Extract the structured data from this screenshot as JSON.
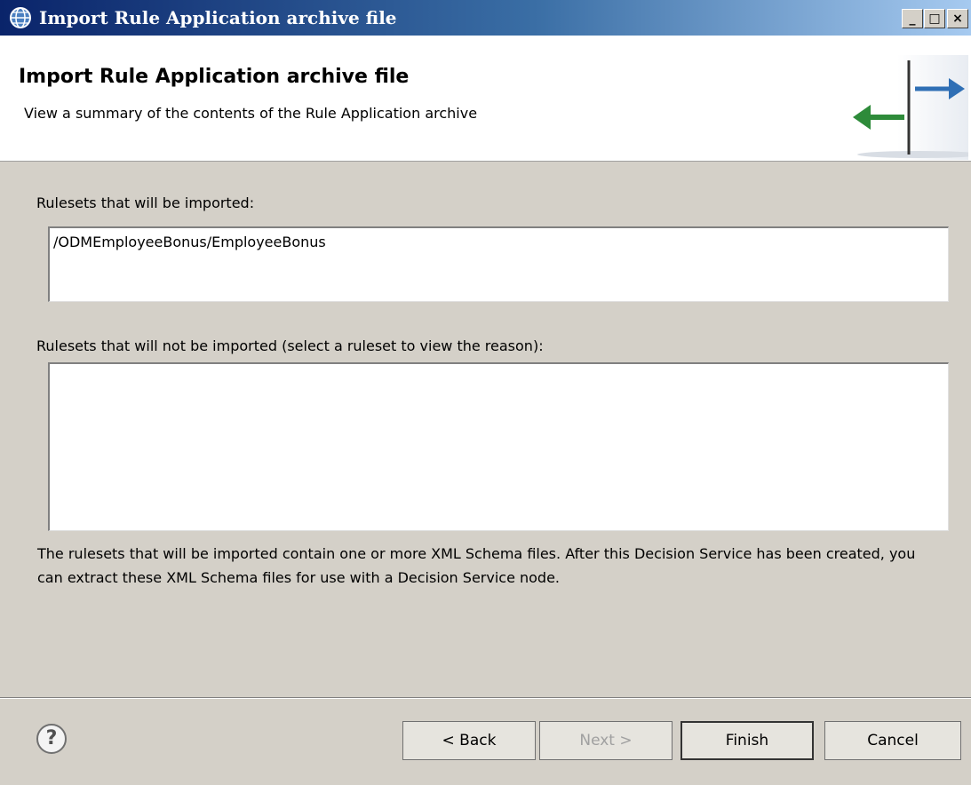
{
  "window": {
    "title": "Import Rule Application archive file",
    "controls": {
      "minimize": "_",
      "maximize": "□",
      "close": "×"
    }
  },
  "header": {
    "title": "Import Rule Application archive file",
    "subtitle": "View a summary of the contents of the Rule Application archive"
  },
  "imported": {
    "label": "Rulesets that will be imported:",
    "items": [
      "/ODMEmployeeBonus/EmployeeBonus"
    ]
  },
  "not_imported": {
    "label": "Rulesets that will not be imported (select a ruleset to view the reason):",
    "items": []
  },
  "note": "The rulesets that will be imported contain one or more XML Schema files. After this Decision Service has been created, you can extract these XML Schema files for use with a Decision Service node.",
  "footer": {
    "help": "?",
    "back": "< Back",
    "next": "Next >",
    "finish": "Finish",
    "cancel": "Cancel"
  },
  "colors": {
    "arrow_left": "#2e8b3a",
    "arrow_right": "#2f6fb5"
  }
}
